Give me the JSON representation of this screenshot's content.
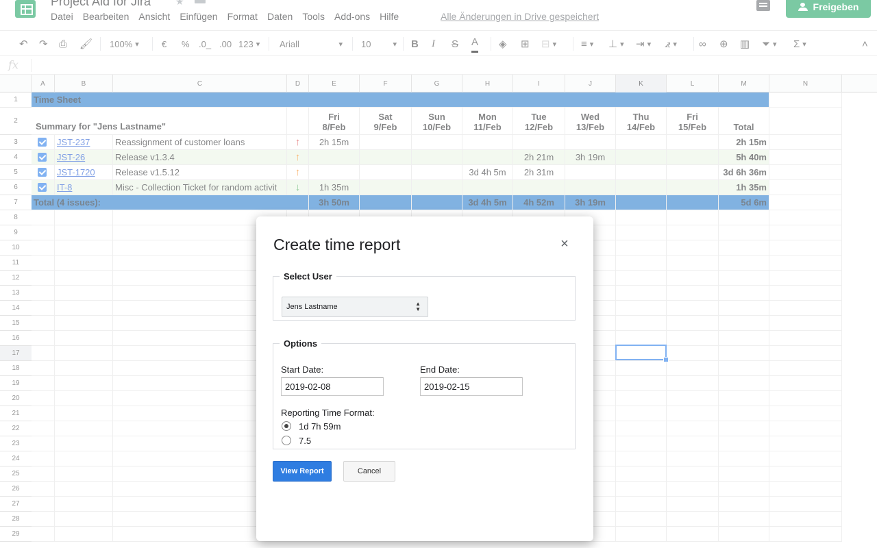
{
  "app": {
    "title": "Project Aid for Jira",
    "menu": [
      "Datei",
      "Bearbeiten",
      "Ansicht",
      "Einfügen",
      "Format",
      "Daten",
      "Tools",
      "Add-ons",
      "Hilfe"
    ],
    "saved_status": "Alle Änderungen in Drive gespeichert",
    "share_label": "Freigeben"
  },
  "toolbar": {
    "zoom": "100%",
    "currency": "€",
    "percent": "%",
    "decimal_less": ".0_",
    "decimal_more": ".00",
    "number_format": "123",
    "font": "Ariall",
    "font_size": "10",
    "bold": "B",
    "italic": "I",
    "strike": "S",
    "text_color": "A",
    "sum": "Σ"
  },
  "formula_bar": {
    "fx": "fx"
  },
  "grid": {
    "columns": [
      "A",
      "B",
      "C",
      "D",
      "E",
      "F",
      "G",
      "H",
      "I",
      "J",
      "K",
      "L",
      "M",
      "N"
    ],
    "row_numbers": [
      "1",
      "2",
      "3",
      "4",
      "5",
      "6",
      "7",
      "8",
      "9",
      "10",
      "11",
      "12",
      "13",
      "14",
      "15",
      "16",
      "17",
      "18",
      "19",
      "20",
      "21",
      "22",
      "23",
      "24",
      "25",
      "26",
      "27",
      "28",
      "29"
    ],
    "selected_column": "K",
    "selected_row": "17",
    "sheet_title": "Time Sheet",
    "summary_label": "Summary for \"Jens Lastname\"",
    "day_headers": [
      {
        "day": "Fri",
        "date": "8/Feb"
      },
      {
        "day": "Sat",
        "date": "9/Feb"
      },
      {
        "day": "Sun",
        "date": "10/Feb"
      },
      {
        "day": "Mon",
        "date": "11/Feb"
      },
      {
        "day": "Tue",
        "date": "12/Feb"
      },
      {
        "day": "Wed",
        "date": "13/Feb"
      },
      {
        "day": "Thu",
        "date": "14/Feb"
      },
      {
        "day": "Fri",
        "date": "15/Feb"
      }
    ],
    "total_header": "Total",
    "issues": [
      {
        "key": "JST-237",
        "summary": "Reassignment of customer loans",
        "priority": "highest",
        "arrow": "↑",
        "times": [
          "2h 15m",
          "",
          "",
          "",
          "",
          "",
          "",
          ""
        ],
        "total": "2h 15m",
        "highlight": false
      },
      {
        "key": "JST-26",
        "summary": "Release v1.3.4",
        "priority": "high",
        "arrow": "↑",
        "times": [
          "",
          "",
          "",
          "",
          "2h 21m",
          "3h 19m",
          "",
          ""
        ],
        "total": "5h 40m",
        "highlight": true
      },
      {
        "key": "JST-1720",
        "summary": "Release v1.5.12",
        "priority": "high",
        "arrow": "↑",
        "times": [
          "",
          "",
          "",
          "3d 4h 5m",
          "2h 31m",
          "",
          "",
          ""
        ],
        "total": "3d 6h 36m",
        "highlight": false
      },
      {
        "key": "IT-8",
        "summary": "Misc - Collection Ticket for random activit",
        "priority": "low",
        "arrow": "↓",
        "times": [
          "1h 35m",
          "",
          "",
          "",
          "",
          "",
          "",
          ""
        ],
        "total": "1h 35m",
        "highlight": true
      }
    ],
    "totals": {
      "label": "Total (4 issues):",
      "days": [
        "3h 50m",
        "",
        "",
        "3d 4h 5m",
        "4h 52m",
        "3h 19m",
        "",
        ""
      ],
      "total": "5d 6m"
    }
  },
  "dialog": {
    "title": "Create time report",
    "close": "×",
    "user_group_legend": "Select User",
    "selected_user": "Jens Lastname",
    "options_legend": "Options",
    "start_label": "Start Date:",
    "start_value": "2019-02-08",
    "end_label": "End Date:",
    "end_value": "2019-02-15",
    "format_label": "Reporting Time Format:",
    "format_options": [
      {
        "label": "1d 7h 59m",
        "selected": true
      },
      {
        "label": "7.5",
        "selected": false
      }
    ],
    "view_button": "View Report",
    "cancel_button": "Cancel"
  },
  "colors": {
    "brand_green": "#0f9d58",
    "header_band": "#1a73c8",
    "row_highlight": "#e9f5e4",
    "primary_button": "#2f7de1"
  }
}
